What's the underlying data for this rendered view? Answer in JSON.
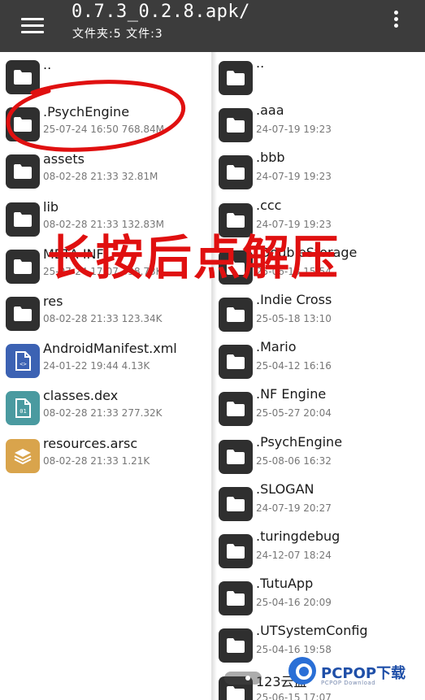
{
  "header": {
    "title": "0.7.3_0.2.8.apk/",
    "subtitle": "文件夹:5 文件:3",
    "menu_icon": "hamburger-menu-icon",
    "overflow_icon": "more-vertical-icon"
  },
  "left_pane": {
    "items": [
      {
        "name": "..",
        "meta": "",
        "type": "folder"
      },
      {
        "name": ".PsychEngine",
        "meta": "25-07-24 16:50  768.84M",
        "type": "folder"
      },
      {
        "name": "assets",
        "meta": "08-02-28 21:33  32.81M",
        "type": "folder"
      },
      {
        "name": "lib",
        "meta": "08-02-28 21:33  132.83M",
        "type": "folder"
      },
      {
        "name": "META-INF",
        "meta": "25-07-24 17:07  338.73K",
        "type": "folder"
      },
      {
        "name": "res",
        "meta": "08-02-28 21:33  123.34K",
        "type": "folder"
      },
      {
        "name": "AndroidManifest.xml",
        "meta": "24-01-22 19:44  4.13K",
        "type": "xml"
      },
      {
        "name": "classes.dex",
        "meta": "08-02-28 21:33  277.32K",
        "type": "dex"
      },
      {
        "name": "resources.arsc",
        "meta": "08-02-28 21:33  1.21K",
        "type": "arsc"
      }
    ]
  },
  "right_pane": {
    "items": [
      {
        "name": "..",
        "meta": "",
        "type": "folder"
      },
      {
        "name": ".aaa",
        "meta": "24-07-19 19:23",
        "type": "folder"
      },
      {
        "name": ".bbb",
        "meta": "24-07-19 19:23",
        "type": "folder"
      },
      {
        "name": ".ccc",
        "meta": "24-07-19 19:23",
        "type": "folder"
      },
      {
        "name": ".DoubleStorage",
        "meta": "25-06-13 15:54",
        "type": "folder"
      },
      {
        "name": ".Indie Cross",
        "meta": "25-05-18 13:10",
        "type": "folder"
      },
      {
        "name": ".Mario",
        "meta": "25-04-12 16:16",
        "type": "folder"
      },
      {
        "name": ".NF Engine",
        "meta": "25-05-27 20:04",
        "type": "folder"
      },
      {
        "name": ".PsychEngine",
        "meta": "25-08-06 16:32",
        "type": "folder"
      },
      {
        "name": ".SLOGAN",
        "meta": "24-07-19 20:27",
        "type": "folder"
      },
      {
        "name": ".turingdebug",
        "meta": "24-12-07 18:24",
        "type": "folder"
      },
      {
        "name": ".TutuApp",
        "meta": "25-04-16 20:09",
        "type": "folder"
      },
      {
        "name": ".UTSystemConfig",
        "meta": "25-04-16 19:58",
        "type": "folder"
      },
      {
        "name": "123云盘",
        "meta": "25-06-15 17:07",
        "type": "folder"
      }
    ]
  },
  "annotation": {
    "text": "长按后点解压",
    "color": "#e01010"
  },
  "watermark": {
    "text": "PCPOP下载",
    "sub": "PCPOP Download"
  },
  "colors": {
    "topbar": "#3c3c3c",
    "folder": "#2f2f2f",
    "xml": "#3c62b3",
    "dex": "#4a9aa0",
    "arsc": "#d9a44c"
  }
}
